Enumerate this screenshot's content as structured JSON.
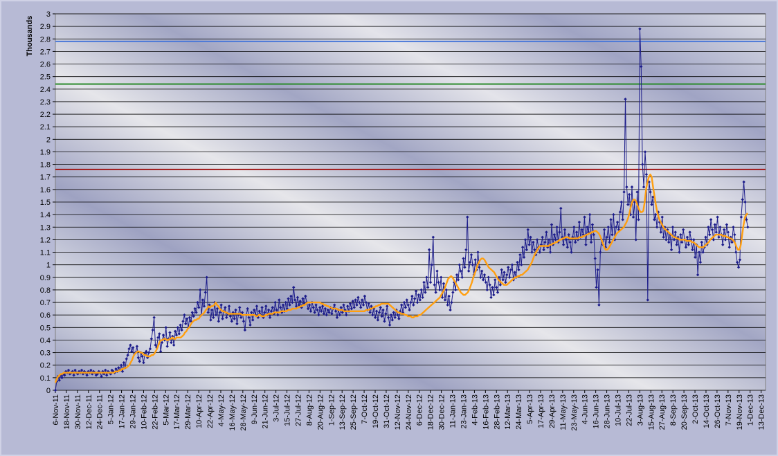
{
  "chart_data": {
    "type": "line",
    "ylabel": "Thousands",
    "xlabel": "",
    "title": "",
    "ylim": [
      0,
      3
    ],
    "y_ticks": [
      "0",
      "0.1",
      "0.2",
      "0.3",
      "0.4",
      "0.5",
      "0.6",
      "0.7",
      "0.8",
      "0.9",
      "1",
      "1.1",
      "1.2",
      "1.3",
      "1.4",
      "1.5",
      "1.6",
      "1.7",
      "1.8",
      "1.9",
      "2",
      "2.1",
      "2.2",
      "2.3",
      "2.4",
      "2.5",
      "2.6",
      "2.7",
      "2.8",
      "2.9",
      "3"
    ],
    "x_ticks": [
      "6-Nov-11",
      "18-Nov-11",
      "30-Nov-11",
      "12-Dec-11",
      "24-Dec-11",
      "5-Jan-12",
      "17-Jan-12",
      "29-Jan-12",
      "10-Feb-12",
      "22-Feb-12",
      "5-Mar-12",
      "17-Mar-12",
      "29-Mar-12",
      "10-Apr-12",
      "22-Apr-12",
      "4-May-12",
      "16-May-12",
      "28-May-12",
      "9-Jun-12",
      "21-Jun-12",
      "3-Jul-12",
      "15-Jul-12",
      "27-Jul-12",
      "8-Aug-12",
      "20-Aug-12",
      "1-Sep-12",
      "13-Sep-12",
      "25-Sep-12",
      "7-Oct-12",
      "19-Oct-12",
      "31-Oct-12",
      "12-Nov-12",
      "24-Nov-12",
      "6-Dec-12",
      "18-Dec-12",
      "30-Dec-12",
      "11-Jan-13",
      "23-Jan-13",
      "4-Feb-13",
      "16-Feb-13",
      "28-Feb-13",
      "12-Mar-13",
      "24-Mar-13",
      "5-Apr-13",
      "17-Apr-13",
      "29-Apr-13",
      "11-May-13",
      "23-May-13",
      "4-Jun-13",
      "16-Jun-13",
      "28-Jun-13",
      "10-Jul-13",
      "22-Jul-13",
      "3-Aug-13",
      "15-Aug-13",
      "27-Aug-13",
      "8-Sep-13",
      "20-Sep-13",
      "2-Oct-13",
      "14-Oct-13",
      "26-Oct-13",
      "7-Nov-13",
      "19-Nov-13",
      "1-Dec-13",
      "13-Dec-13"
    ],
    "grid": true,
    "reference_lines": [
      {
        "value": 2.78,
        "color": "#4a78d8"
      },
      {
        "value": 2.44,
        "color": "#2a8a2a"
      },
      {
        "value": 1.76,
        "color": "#a01818"
      }
    ],
    "series": [
      {
        "color": "#1c1c8a",
        "marker": "diamond",
        "values": [
          0.0,
          0.07,
          0.11,
          0.08,
          0.12,
          0.1,
          0.13,
          0.12,
          0.15,
          0.14,
          0.16,
          0.13,
          0.14,
          0.15,
          0.12,
          0.16,
          0.14,
          0.13,
          0.15,
          0.14,
          0.16,
          0.13,
          0.15,
          0.14,
          0.12,
          0.15,
          0.14,
          0.16,
          0.13,
          0.15,
          0.14,
          0.12,
          0.13,
          0.15,
          0.14,
          0.11,
          0.15,
          0.13,
          0.16,
          0.12,
          0.15,
          0.14,
          0.13,
          0.16,
          0.15,
          0.14,
          0.17,
          0.15,
          0.18,
          0.16,
          0.2,
          0.15,
          0.22,
          0.18,
          0.25,
          0.28,
          0.33,
          0.36,
          0.31,
          0.34,
          0.29,
          0.3,
          0.35,
          0.26,
          0.23,
          0.3,
          0.27,
          0.22,
          0.29,
          0.31,
          0.26,
          0.3,
          0.33,
          0.41,
          0.48,
          0.58,
          0.36,
          0.34,
          0.42,
          0.45,
          0.31,
          0.38,
          0.44,
          0.4,
          0.5,
          0.35,
          0.41,
          0.46,
          0.38,
          0.43,
          0.36,
          0.47,
          0.44,
          0.5,
          0.45,
          0.52,
          0.48,
          0.55,
          0.6,
          0.53,
          0.57,
          0.5,
          0.58,
          0.55,
          0.62,
          0.59,
          0.65,
          0.62,
          0.7,
          0.66,
          0.8,
          0.6,
          0.72,
          0.67,
          0.78,
          0.9,
          0.62,
          0.68,
          0.56,
          0.64,
          0.58,
          0.7,
          0.6,
          0.65,
          0.55,
          0.62,
          0.68,
          0.57,
          0.63,
          0.66,
          0.58,
          0.61,
          0.67,
          0.59,
          0.55,
          0.62,
          0.57,
          0.64,
          0.53,
          0.6,
          0.66,
          0.58,
          0.62,
          0.55,
          0.48,
          0.6,
          0.65,
          0.58,
          0.52,
          0.62,
          0.56,
          0.64,
          0.6,
          0.67,
          0.58,
          0.63,
          0.6,
          0.66,
          0.58,
          0.62,
          0.67,
          0.6,
          0.64,
          0.58,
          0.63,
          0.66,
          0.61,
          0.7,
          0.64,
          0.6,
          0.72,
          0.66,
          0.62,
          0.68,
          0.63,
          0.7,
          0.65,
          0.73,
          0.68,
          0.75,
          0.7,
          0.82,
          0.72,
          0.67,
          0.74,
          0.68,
          0.71,
          0.66,
          0.73,
          0.69,
          0.75,
          0.7,
          0.65,
          0.68,
          0.63,
          0.7,
          0.66,
          0.62,
          0.68,
          0.64,
          0.6,
          0.66,
          0.63,
          0.67,
          0.61,
          0.65,
          0.6,
          0.64,
          0.62,
          0.66,
          0.61,
          0.65,
          0.68,
          0.63,
          0.58,
          0.64,
          0.6,
          0.66,
          0.62,
          0.68,
          0.64,
          0.6,
          0.67,
          0.63,
          0.69,
          0.65,
          0.71,
          0.66,
          0.72,
          0.68,
          0.74,
          0.7,
          0.66,
          0.72,
          0.68,
          0.75,
          0.7,
          0.64,
          0.69,
          0.62,
          0.67,
          0.6,
          0.65,
          0.58,
          0.63,
          0.56,
          0.62,
          0.66,
          0.59,
          0.64,
          0.55,
          0.61,
          0.67,
          0.58,
          0.52,
          0.6,
          0.56,
          0.62,
          0.58,
          0.64,
          0.6,
          0.57,
          0.63,
          0.68,
          0.62,
          0.7,
          0.66,
          0.72,
          0.68,
          0.64,
          0.7,
          0.75,
          0.68,
          0.73,
          0.79,
          0.7,
          0.76,
          0.72,
          0.8,
          0.74,
          0.86,
          0.78,
          0.9,
          0.82,
          1.12,
          0.86,
          1.0,
          1.22,
          0.84,
          0.78,
          0.95,
          0.86,
          0.8,
          0.9,
          0.74,
          0.85,
          0.72,
          0.8,
          0.68,
          0.75,
          0.64,
          0.7,
          0.78,
          0.86,
          0.8,
          0.92,
          0.88,
          1.0,
          0.95,
          0.9,
          1.05,
          0.98,
          1.12,
          1.38,
          0.95,
          1.02,
          1.08,
          1.0,
          0.92,
          1.04,
          0.96,
          1.1,
          0.98,
          0.9,
          0.95,
          0.88,
          0.92,
          0.86,
          0.8,
          0.9,
          0.84,
          0.74,
          0.82,
          0.76,
          0.88,
          0.82,
          0.78,
          0.9,
          0.84,
          0.96,
          0.88,
          0.94,
          0.86,
          0.92,
          0.98,
          0.9,
          0.96,
          1.0,
          0.88,
          0.94,
          0.9,
          1.02,
          0.96,
          1.08,
          1.0,
          1.14,
          1.06,
          1.2,
          1.12,
          1.28,
          1.16,
          1.22,
          1.1,
          1.18,
          1.12,
          1.08,
          1.2,
          1.14,
          1.1,
          1.16,
          1.22,
          1.12,
          1.18,
          1.26,
          1.14,
          1.2,
          1.1,
          1.32,
          1.16,
          1.24,
          1.2,
          1.3,
          1.18,
          1.26,
          1.45,
          1.22,
          1.16,
          1.28,
          1.2,
          1.14,
          1.24,
          1.18,
          1.1,
          1.22,
          1.3,
          1.18,
          1.26,
          1.2,
          1.34,
          1.22,
          1.28,
          1.24,
          1.38,
          1.16,
          1.3,
          1.26,
          1.4,
          1.18,
          1.32,
          1.24,
          1.05,
          0.82,
          0.96,
          0.68,
          1.1,
          1.2,
          1.16,
          1.28,
          1.14,
          1.22,
          1.3,
          1.18,
          1.36,
          1.24,
          1.4,
          1.2,
          1.3,
          1.34,
          1.28,
          1.42,
          1.5,
          1.36,
          1.58,
          2.32,
          1.62,
          1.48,
          1.56,
          1.4,
          1.62,
          1.38,
          1.5,
          1.2,
          1.58,
          1.36,
          2.88,
          2.58,
          1.8,
          1.62,
          1.9,
          1.72,
          0.72,
          1.66,
          1.58,
          1.48,
          1.54,
          1.36,
          1.4,
          1.3,
          1.42,
          1.34,
          1.26,
          1.38,
          1.22,
          1.3,
          1.2,
          1.28,
          1.18,
          1.24,
          1.12,
          1.3,
          1.2,
          1.26,
          1.16,
          1.22,
          1.1,
          1.24,
          1.18,
          1.28,
          1.2,
          1.14,
          1.22,
          1.16,
          1.26,
          1.2,
          1.12,
          1.2,
          1.06,
          1.16,
          0.92,
          1.1,
          1.02,
          1.18,
          1.1,
          1.14,
          1.22,
          1.16,
          1.3,
          1.24,
          1.36,
          1.28,
          1.2,
          1.32,
          1.26,
          1.38,
          1.22,
          1.3,
          1.24,
          1.16,
          1.28,
          1.2,
          1.32,
          1.26,
          1.14,
          1.22,
          1.18,
          1.3,
          1.24,
          1.1,
          1.02,
          0.98,
          1.04,
          1.38,
          1.52,
          1.66,
          1.5,
          1.36,
          1.3
        ]
      },
      {
        "color": "#ff9f10",
        "values": [
          0.06,
          0.09,
          0.11,
          0.12,
          0.13,
          0.13,
          0.14,
          0.14,
          0.14,
          0.14,
          0.14,
          0.14,
          0.14,
          0.14,
          0.14,
          0.14,
          0.14,
          0.14,
          0.14,
          0.14,
          0.14,
          0.14,
          0.14,
          0.14,
          0.14,
          0.14,
          0.14,
          0.14,
          0.14,
          0.14,
          0.14,
          0.14,
          0.14,
          0.14,
          0.14,
          0.14,
          0.14,
          0.14,
          0.14,
          0.14,
          0.14,
          0.14,
          0.14,
          0.15,
          0.15,
          0.15,
          0.16,
          0.16,
          0.17,
          0.17,
          0.18,
          0.18,
          0.19,
          0.2,
          0.22,
          0.24,
          0.27,
          0.29,
          0.3,
          0.31,
          0.31,
          0.3,
          0.3,
          0.29,
          0.28,
          0.28,
          0.27,
          0.27,
          0.27,
          0.28,
          0.28,
          0.29,
          0.31,
          0.33,
          0.36,
          0.39,
          0.4,
          0.4,
          0.41,
          0.41,
          0.4,
          0.4,
          0.41,
          0.41,
          0.42,
          0.41,
          0.41,
          0.42,
          0.42,
          0.42,
          0.42,
          0.43,
          0.44,
          0.46,
          0.47,
          0.49,
          0.5,
          0.52,
          0.54,
          0.55,
          0.56,
          0.56,
          0.57,
          0.57,
          0.59,
          0.6,
          0.61,
          0.62,
          0.64,
          0.65,
          0.67,
          0.66,
          0.67,
          0.67,
          0.68,
          0.7,
          0.68,
          0.67,
          0.65,
          0.64,
          0.63,
          0.63,
          0.62,
          0.62,
          0.61,
          0.61,
          0.61,
          0.61,
          0.61,
          0.61,
          0.61,
          0.61,
          0.61,
          0.61,
          0.6,
          0.6,
          0.6,
          0.6,
          0.6,
          0.6,
          0.6,
          0.6,
          0.6,
          0.6,
          0.59,
          0.59,
          0.6,
          0.6,
          0.59,
          0.59,
          0.59,
          0.6,
          0.6,
          0.61,
          0.61,
          0.61,
          0.61,
          0.62,
          0.62,
          0.62,
          0.62,
          0.62,
          0.63,
          0.63,
          0.63,
          0.63,
          0.63,
          0.64,
          0.64,
          0.64,
          0.65,
          0.65,
          0.65,
          0.65,
          0.66,
          0.66,
          0.67,
          0.67,
          0.68,
          0.68,
          0.69,
          0.7,
          0.7,
          0.7,
          0.7,
          0.7,
          0.7,
          0.7,
          0.7,
          0.7,
          0.7,
          0.69,
          0.69,
          0.68,
          0.68,
          0.67,
          0.67,
          0.66,
          0.66,
          0.65,
          0.65,
          0.65,
          0.65,
          0.64,
          0.64,
          0.64,
          0.64,
          0.63,
          0.63,
          0.63,
          0.63,
          0.63,
          0.63,
          0.63,
          0.63,
          0.63,
          0.63,
          0.63,
          0.63,
          0.63,
          0.63,
          0.63,
          0.63,
          0.64,
          0.64,
          0.64,
          0.65,
          0.65,
          0.66,
          0.66,
          0.67,
          0.67,
          0.68,
          0.68,
          0.69,
          0.69,
          0.69,
          0.69,
          0.69,
          0.69,
          0.68,
          0.67,
          0.66,
          0.65,
          0.64,
          0.63,
          0.62,
          0.62,
          0.61,
          0.61,
          0.61,
          0.6,
          0.6,
          0.59,
          0.59,
          0.59,
          0.58,
          0.58,
          0.59,
          0.59,
          0.59,
          0.6,
          0.6,
          0.61,
          0.62,
          0.63,
          0.64,
          0.65,
          0.66,
          0.67,
          0.68,
          0.69,
          0.7,
          0.71,
          0.72,
          0.73,
          0.74,
          0.76,
          0.78,
          0.8,
          0.83,
          0.86,
          0.89,
          0.9,
          0.91,
          0.9,
          0.88,
          0.86,
          0.84,
          0.82,
          0.8,
          0.78,
          0.77,
          0.76,
          0.76,
          0.77,
          0.78,
          0.8,
          0.83,
          0.86,
          0.9,
          0.93,
          0.96,
          1.0,
          1.02,
          1.04,
          1.05,
          1.05,
          1.04,
          1.02,
          1.0,
          0.98,
          0.97,
          0.96,
          0.95,
          0.94,
          0.92,
          0.9,
          0.88,
          0.87,
          0.86,
          0.85,
          0.84,
          0.84,
          0.84,
          0.85,
          0.86,
          0.87,
          0.88,
          0.89,
          0.9,
          0.9,
          0.91,
          0.91,
          0.92,
          0.92,
          0.93,
          0.94,
          0.95,
          0.96,
          0.98,
          1.0,
          1.02,
          1.05,
          1.08,
          1.1,
          1.12,
          1.14,
          1.15,
          1.15,
          1.15,
          1.15,
          1.15,
          1.15,
          1.15,
          1.16,
          1.16,
          1.17,
          1.17,
          1.18,
          1.18,
          1.19,
          1.2,
          1.2,
          1.21,
          1.21,
          1.22,
          1.22,
          1.22,
          1.21,
          1.21,
          1.21,
          1.21,
          1.21,
          1.21,
          1.21,
          1.22,
          1.22,
          1.22,
          1.23,
          1.23,
          1.24,
          1.24,
          1.25,
          1.25,
          1.26,
          1.26,
          1.27,
          1.27,
          1.26,
          1.25,
          1.23,
          1.2,
          1.17,
          1.14,
          1.12,
          1.12,
          1.13,
          1.15,
          1.17,
          1.19,
          1.21,
          1.23,
          1.25,
          1.26,
          1.27,
          1.28,
          1.29,
          1.3,
          1.32,
          1.34,
          1.37,
          1.41,
          1.46,
          1.5,
          1.52,
          1.52,
          1.5,
          1.47,
          1.44,
          1.42,
          1.42,
          1.43,
          1.5,
          1.6,
          1.66,
          1.7,
          1.72,
          1.7,
          1.62,
          1.55,
          1.48,
          1.42,
          1.38,
          1.35,
          1.33,
          1.31,
          1.29,
          1.28,
          1.27,
          1.26,
          1.25,
          1.24,
          1.23,
          1.22,
          1.22,
          1.21,
          1.21,
          1.2,
          1.2,
          1.2,
          1.2,
          1.2,
          1.19,
          1.19,
          1.19,
          1.19,
          1.18,
          1.18,
          1.17,
          1.16,
          1.15,
          1.14,
          1.14,
          1.14,
          1.14,
          1.15,
          1.16,
          1.17,
          1.18,
          1.2,
          1.21,
          1.22,
          1.23,
          1.24,
          1.24,
          1.24,
          1.24,
          1.24,
          1.23,
          1.23,
          1.23,
          1.22,
          1.22,
          1.21,
          1.21,
          1.2,
          1.19,
          1.17,
          1.14,
          1.12,
          1.12,
          1.16,
          1.24,
          1.32,
          1.38,
          1.4,
          1.41
        ]
      }
    ]
  }
}
